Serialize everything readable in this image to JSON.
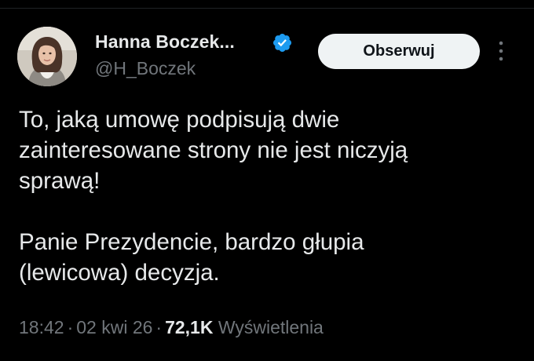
{
  "author": {
    "display_name": "Hanna Boczek...",
    "handle": "@H_Boczek",
    "verified": true,
    "avatar_icon": "profile-photo"
  },
  "follow_button": {
    "label": "Obserwuj"
  },
  "more_menu": {
    "icon": "more-vertical-icon"
  },
  "tweet": {
    "lines": [
      "To, jaką umowę podpisują dwie",
      "zainteresowane strony nie jest niczyją",
      "sprawą!",
      "",
      "Panie Prezydencie, bardzo głupia",
      "(lewicowa) decyzja."
    ]
  },
  "meta": {
    "time": "18:42",
    "separator": "·",
    "date": "02 kwi 26",
    "views_count": "72,1K",
    "views_label": "Wyświetlenia"
  },
  "colors": {
    "background": "#000000",
    "text": "#e7e9ea",
    "secondary": "#71767b",
    "verified": "#1d9bf0",
    "button_bg": "#eff3f4"
  }
}
